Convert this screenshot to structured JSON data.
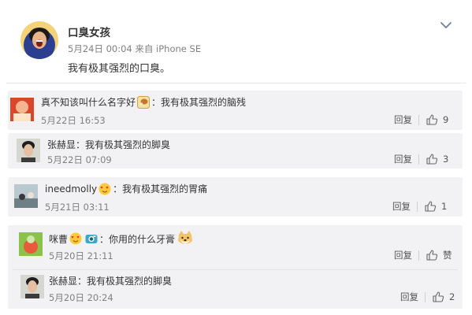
{
  "post": {
    "author": "口臭女孩",
    "meta": "5月24日 00:04 来自 iPhone SE",
    "text": "我有极其强烈的口臭。",
    "avatar_icon": "avatar-laughing-woman"
  },
  "comments": [
    {
      "user": "真不知该叫什么名字好",
      "emoji": "chicken-leg-emoji",
      "text": "：我有极其强烈的脑残",
      "time": "5月22日 16:53",
      "reply_label": "回复",
      "likes": "9"
    },
    {
      "user": "张赫显",
      "text": "：我有极其强烈的脚臭",
      "time": "5月22日 07:09",
      "reply_label": "回复",
      "likes": "3"
    },
    {
      "user": "ineedmolly",
      "emoji": "heart-eyes-emoji",
      "text": "：我有极其强烈的胃痛",
      "time": "5月21日 03:11",
      "reply_label": "回复",
      "likes": "1"
    },
    {
      "user": "咪曹",
      "text": "：你用的什么牙膏",
      "emojis": [
        "heart-eyes-emoji",
        "camera-emoji",
        "doge-emoji"
      ],
      "time": "5月20日 21:11",
      "reply_label": "回复",
      "likes": "赞",
      "reply": {
        "user": "张赫显",
        "text": "：我有极其强烈的脚臭",
        "time": "5月20日 20:24",
        "reply_label": "回复",
        "likes": "2"
      }
    }
  ],
  "colors": {
    "link": "#eb7350",
    "comment_bg": "#f2f2f5",
    "meta": "#808080"
  }
}
